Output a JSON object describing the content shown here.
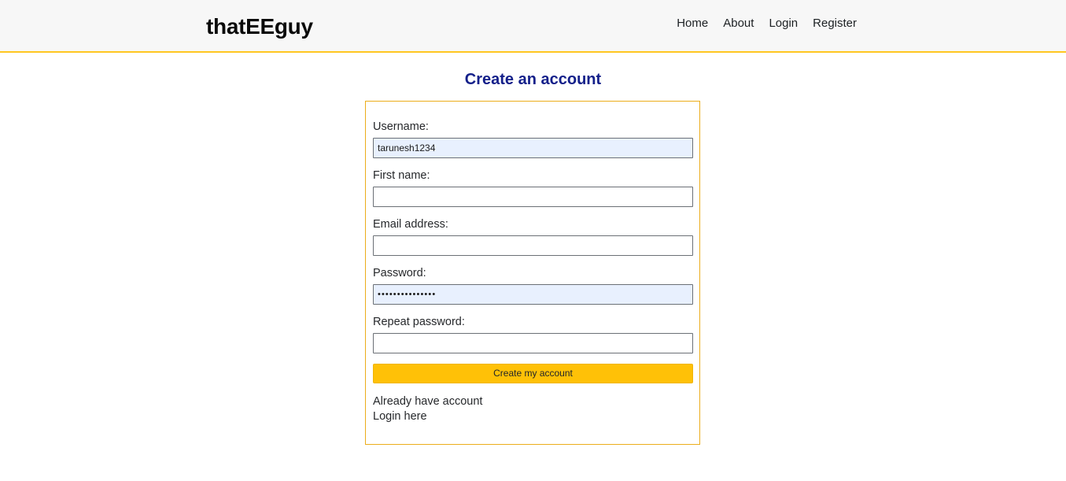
{
  "header": {
    "brand": "thatEEguy",
    "nav": [
      {
        "label": "Home"
      },
      {
        "label": "About"
      },
      {
        "label": "Login"
      },
      {
        "label": "Register"
      }
    ]
  },
  "page": {
    "title": "Create an account"
  },
  "form": {
    "fields": [
      {
        "name": "username",
        "label": "Username:",
        "value": "tarunesh1234",
        "placeholder": "",
        "autofilled": true
      },
      {
        "name": "first-name",
        "label": "First name:",
        "value": "",
        "placeholder": "",
        "autofilled": false
      },
      {
        "name": "email",
        "label": "Email address:",
        "value": "",
        "placeholder": "",
        "autofilled": false
      },
      {
        "name": "password",
        "label": "Password:",
        "value": "•••••••••••••••",
        "placeholder": "",
        "autofilled": true
      },
      {
        "name": "repeat-password",
        "label": "Repeat password:",
        "value": "",
        "placeholder": "",
        "autofilled": false
      }
    ],
    "submit_label": "Create my account",
    "already_have_account": "Already have account",
    "login_here": "Login here"
  },
  "colors": {
    "accent": "#ffc107",
    "card_border": "#ecad1b",
    "header_border": "#ffc721",
    "header_bg": "#f7f7f7",
    "title": "#14208a",
    "autofill_bg": "#e8f0fe"
  }
}
